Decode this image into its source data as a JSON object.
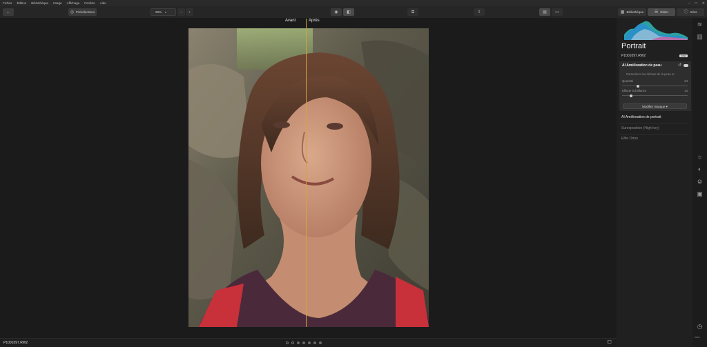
{
  "menubar": {
    "items": [
      "Fichier",
      "Édition",
      "Bibliothèque",
      "Image",
      "Affichage",
      "Fenêtre",
      "Aide"
    ]
  },
  "toolbar": {
    "presets_label": "Présélections",
    "zoom_value": "29%",
    "right_tabs": [
      "Bibliothèque",
      "Éditer",
      "Infos"
    ]
  },
  "compare": {
    "before_label": "Avant",
    "after_label": "Après"
  },
  "bottombar": {
    "filename": "P1001097.RW2",
    "dots_count": 6
  },
  "panel": {
    "title": "Portrait",
    "filename": "P1001097.RW2",
    "badge": "RAW",
    "skin_card": {
      "title": "AI Amélioration de peau",
      "description": "Paramétrer les défauts de la peau et",
      "sliders": [
        {
          "label": "Quantité",
          "value": "24",
          "position": 0.24
        },
        {
          "label": "Effacer la brillance",
          "value": "14",
          "position": 0.14
        }
      ],
      "mask_button": "Modifier masque"
    },
    "sections": [
      {
        "label": "AI Amélioration de portrait",
        "style": "bright"
      },
      {
        "label": "Surexposition (High-key)",
        "style": "dim"
      },
      {
        "label": "Effet Orton",
        "style": "dim"
      }
    ]
  },
  "icon_strip": {
    "icons": [
      "layers-icon",
      "compare-panels-icon",
      "light-icon",
      "color-palette-icon",
      "portrait-face-icon",
      "frame-icon",
      "history-icon"
    ],
    "bottom_label": "Infos"
  },
  "colors": {
    "accent_divider": "#d9a23a",
    "background": "#1b1b1b",
    "panel": "#202020"
  }
}
